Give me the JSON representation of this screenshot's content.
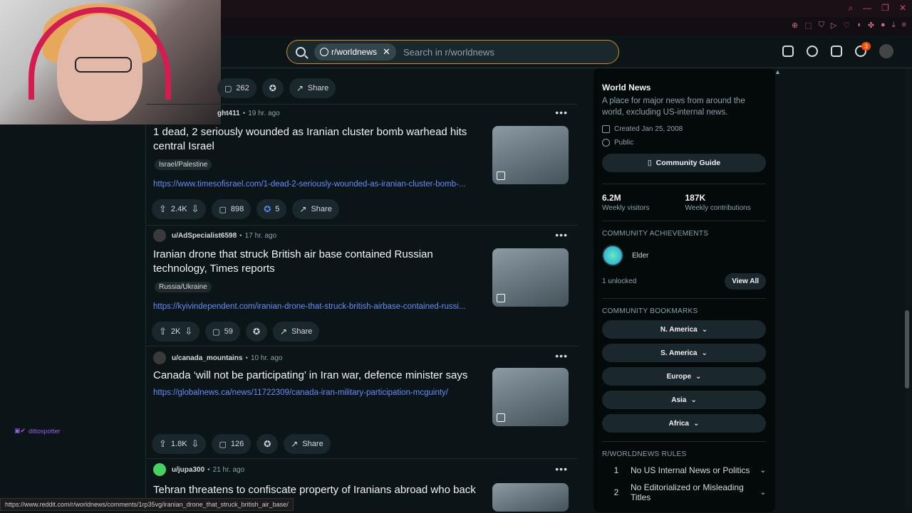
{
  "search": {
    "community_chip": "r/worldnews",
    "placeholder": "Search in r/worldnews"
  },
  "header": {
    "notification_count": "3"
  },
  "chat": {
    "username": "dittospotter"
  },
  "top_post_actions": {
    "comments": "262",
    "share": "Share"
  },
  "posts": [
    {
      "user": "ght411",
      "time": "19 hr. ago",
      "title": "1 dead, 2 seriously wounded as Iranian cluster bomb warhead hits central Israel",
      "flair": "Israel/Palestine",
      "link": "https://www.timesofisrael.com/1-dead-2-seriously-wounded-as-iranian-cluster-bomb-...",
      "votes": "2.4K",
      "comments": "898",
      "awards": "5",
      "share": "Share"
    },
    {
      "user": "u/AdSpecialist6598",
      "time": "17 hr. ago",
      "title": "Iranian drone that struck British air base contained Russian technology, Times reports",
      "flair": "Russia/Ukraine",
      "link": "https://kyivindependent.com/iranian-drone-that-struck-british-airbase-contained-russi...",
      "votes": "2K",
      "comments": "59",
      "share": "Share"
    },
    {
      "user": "u/canada_mountains",
      "time": "10 hr. ago",
      "title": "Canada ‘will not be participating’ in Iran war, defence minister says",
      "link": "https://globalnews.ca/news/11722309/canada-iran-military-participation-mcguinty/",
      "votes": "1.8K",
      "comments": "126",
      "share": "Share"
    },
    {
      "user": "u/jupa300",
      "time": "21 hr. ago",
      "title": "Tehran threatens to confiscate property of Iranians abroad who back"
    }
  ],
  "sidebar": {
    "title": "World News",
    "description": "A place for major news from around the world, excluding US-internal news.",
    "created": "Created Jan 25, 2008",
    "visibility": "Public",
    "guide_button": "Community Guide",
    "visitors": "6.2M",
    "visitors_label": "Weekly visitors",
    "contributions": "187K",
    "contributions_label": "Weekly contributions",
    "achievements_header": "COMMUNITY ACHIEVEMENTS",
    "achievement": "Elder",
    "unlocked": "1 unlocked",
    "view_all": "View All",
    "bookmarks_header": "COMMUNITY BOOKMARKS",
    "bookmarks": [
      "N. America",
      "S. America",
      "Europe",
      "Asia",
      "Africa"
    ],
    "rules_header": "R/WORLDNEWS RULES",
    "rules": [
      {
        "n": "1",
        "text": "No US Internal News or Politics"
      },
      {
        "n": "2",
        "text": "No Editorialized or Misleading Titles"
      }
    ]
  },
  "status_url": "https://www.reddit.com/r/worldnews/comments/1rp35vg/iranian_drone_that_struck_british_air_base/"
}
